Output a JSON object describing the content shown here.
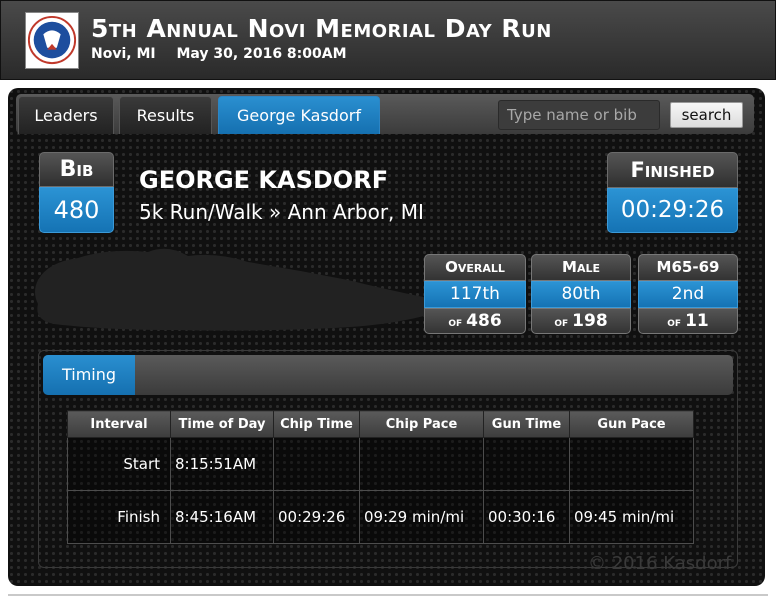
{
  "header": {
    "title": "5th Annual Novi Memorial Day Run",
    "location": "Novi, MI",
    "datetime": "May 30, 2016 8:00AM",
    "logo_icon": "race-logo"
  },
  "tabs": [
    {
      "label": "Leaders",
      "active": false
    },
    {
      "label": "Results",
      "active": false
    },
    {
      "label": "George Kasdorf",
      "active": true
    }
  ],
  "search": {
    "placeholder": "Type name or bib",
    "value": "",
    "button_label": "search"
  },
  "bib": {
    "label": "Bib",
    "number": "480"
  },
  "runner": {
    "name": "GEORGE KASDORF",
    "event_line": "5k Run/Walk » Ann Arbor, MI"
  },
  "finished": {
    "label": "Finished",
    "time": "00:29:26"
  },
  "ranks": [
    {
      "label": "Overall",
      "place": "117th",
      "of_label": "of",
      "total": "486"
    },
    {
      "label": "Male",
      "place": "80th",
      "of_label": "of",
      "total": "198"
    },
    {
      "label": "M65-69",
      "place": "2nd",
      "of_label": "of",
      "total": "11"
    }
  ],
  "timing": {
    "tab_label": "Timing",
    "columns": [
      "Interval",
      "Time of Day",
      "Chip Time",
      "Chip Pace",
      "Gun Time",
      "Gun Pace"
    ],
    "rows": [
      [
        "Start",
        "8:15:51AM",
        "",
        "",
        "",
        ""
      ],
      [
        "Finish",
        "8:45:16AM",
        "00:29:26",
        "09:29 min/mi",
        "00:30:16",
        "09:45 min/mi"
      ]
    ]
  },
  "watermark": "© 2016 Kasdorf",
  "colors": {
    "accent": "#1f85c8",
    "header_bg": "#3a3a3a",
    "panel_bg": "#111111"
  }
}
